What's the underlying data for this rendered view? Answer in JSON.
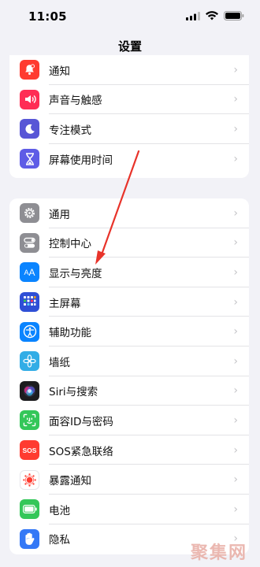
{
  "status": {
    "time": "11:05"
  },
  "header": {
    "title": "设置"
  },
  "group1": [
    {
      "label": "通知",
      "icon": "bell-icon",
      "color": "#ff3b30"
    },
    {
      "label": "声音与触感",
      "icon": "speaker-icon",
      "color": "#ff2d55"
    },
    {
      "label": "专注模式",
      "icon": "moon-icon",
      "color": "#5856d6"
    },
    {
      "label": "屏幕使用时间",
      "icon": "hourglass-icon",
      "color": "#5e5ce6"
    }
  ],
  "group2": [
    {
      "label": "通用",
      "icon": "gear-icon",
      "color": "#8e8e93"
    },
    {
      "label": "控制中心",
      "icon": "toggles-icon",
      "color": "#8e8e93"
    },
    {
      "label": "显示与亮度",
      "icon": "text-size-icon",
      "color": "#0a84ff"
    },
    {
      "label": "主屏幕",
      "icon": "grid-icon",
      "color": "#2f4fd6"
    },
    {
      "label": "辅助功能",
      "icon": "accessibility-icon",
      "color": "#0a84ff"
    },
    {
      "label": "墙纸",
      "icon": "flower-icon",
      "color": "#32ade6"
    },
    {
      "label": "Siri与搜索",
      "icon": "siri-icon",
      "color": "#1c1c1e"
    },
    {
      "label": "面容ID与密码",
      "icon": "faceid-icon",
      "color": "#34c759"
    },
    {
      "label": "SOS紧急联络",
      "icon": "sos-icon",
      "color": "#ff3b30"
    },
    {
      "label": "暴露通知",
      "icon": "exposure-icon",
      "color": "#ffffff"
    },
    {
      "label": "电池",
      "icon": "battery-icon",
      "color": "#34c759"
    },
    {
      "label": "隐私",
      "icon": "hand-icon",
      "color": "#3478f6"
    }
  ],
  "sos_text": "SOS",
  "watermark": "聚集网"
}
